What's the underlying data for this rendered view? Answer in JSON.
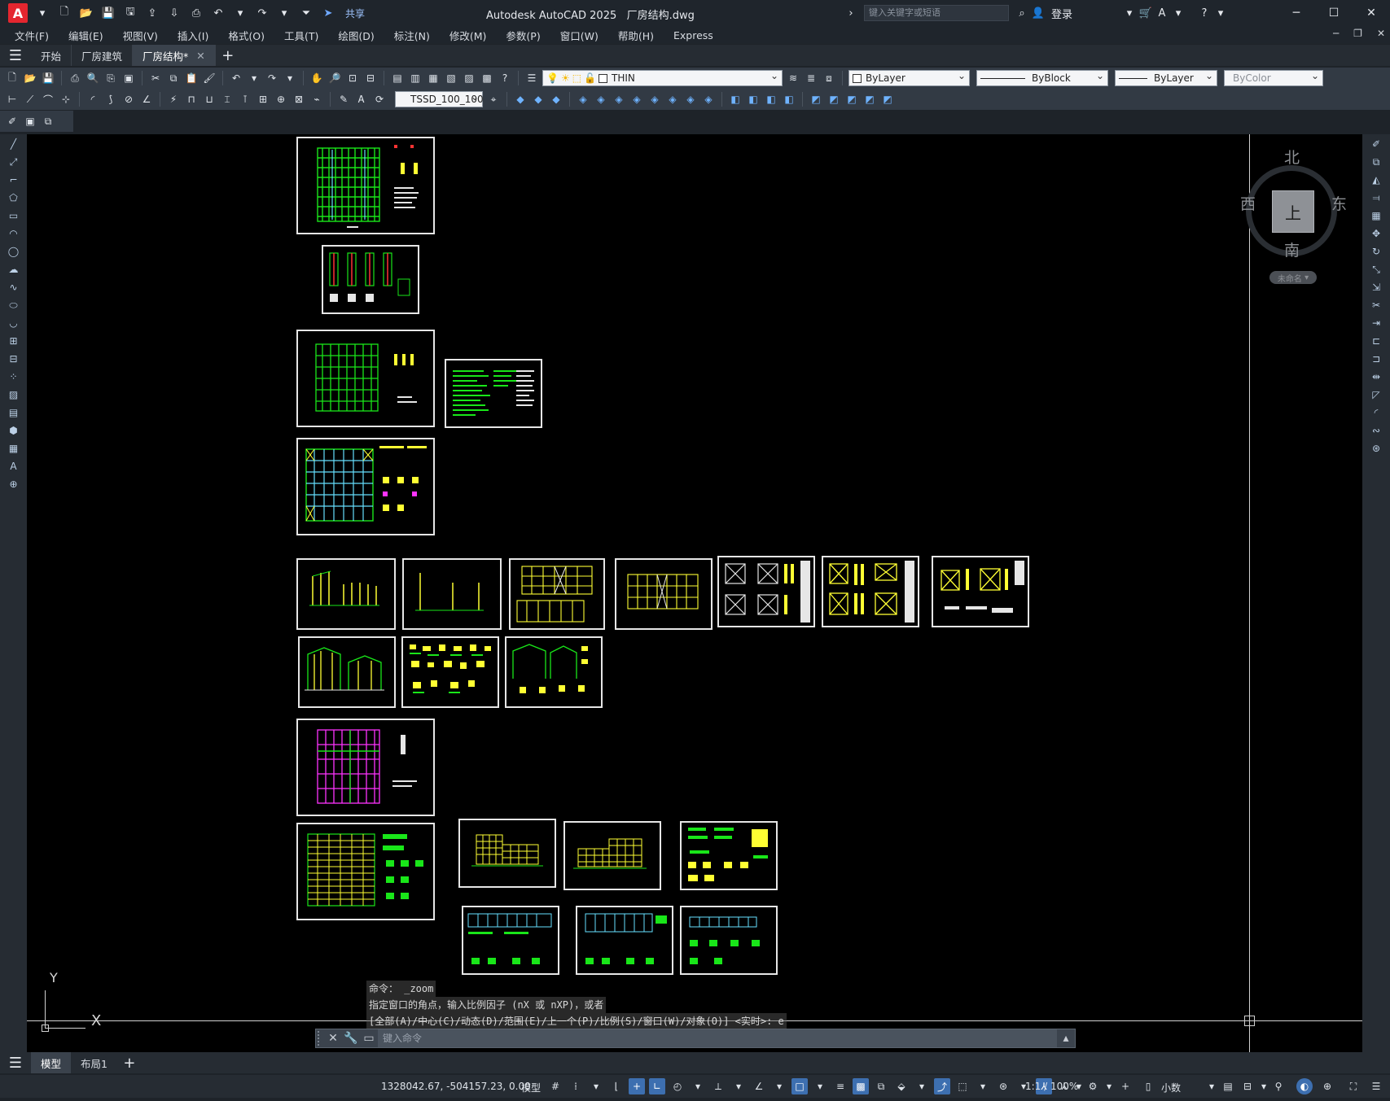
{
  "app": {
    "logo_letter": "A",
    "title": "Autodesk AutoCAD 2025",
    "document": "厂房结构.dwg",
    "share_label": "共享",
    "search_placeholder": "键入关键字或短语",
    "login_label": "登录"
  },
  "menu": [
    "文件(F)",
    "编辑(E)",
    "视图(V)",
    "插入(I)",
    "格式(O)",
    "工具(T)",
    "绘图(D)",
    "标注(N)",
    "修改(M)",
    "参数(P)",
    "窗口(W)",
    "帮助(H)",
    "Express"
  ],
  "file_tabs": [
    {
      "label": "开始",
      "active": false
    },
    {
      "label": "厂房建筑",
      "active": false
    },
    {
      "label": "厂房结构*",
      "active": true
    }
  ],
  "properties": {
    "layer": "THIN",
    "color": "ByLayer",
    "linetype": "ByBlock",
    "lineweight": "ByLayer",
    "plotstyle": "ByColor",
    "dimstyle": "TSSD_100_100"
  },
  "viewcube": {
    "north": "北",
    "south": "南",
    "east": "东",
    "west": "西",
    "face": "上",
    "wcs_label": "未命名"
  },
  "command": {
    "history": [
      "命令：  _zoom",
      "指定窗口的角点，输入比例因子 (nX 或 nXP)，或者",
      "[全部(A)/中心(C)/动态(D)/范围(E)/上一个(P)/比例(S)/窗口(W)/对象(O)] <实时>:  e"
    ],
    "placeholder": "键入命令"
  },
  "ucs": {
    "x": "X",
    "y": "Y"
  },
  "layout_tabs": [
    {
      "label": "模型",
      "active": true
    },
    {
      "label": "布局1",
      "active": false
    }
  ],
  "status": {
    "coords": "1328042.67, -504157.23, 0.00",
    "model": "模型",
    "scale": "1:1 / 100%",
    "units": "小数"
  },
  "colors": {
    "canvas": "#000000",
    "sheet_border": "#e6e6e6",
    "grid_green": "#19e619",
    "accent_yellow": "#ffff33",
    "accent_magenta": "#ff33ff",
    "accent_cyan": "#66e0ff",
    "accent_red": "#ff3333"
  }
}
